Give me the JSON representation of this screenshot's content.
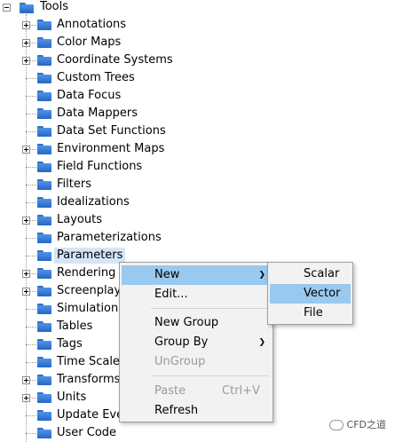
{
  "tree": {
    "root": {
      "label": "Tools",
      "expanded": true
    },
    "items": [
      {
        "label": "Annotations",
        "expandable": true
      },
      {
        "label": "Color Maps",
        "expandable": true
      },
      {
        "label": "Coordinate Systems",
        "expandable": true
      },
      {
        "label": "Custom Trees",
        "expandable": false
      },
      {
        "label": "Data Focus",
        "expandable": false
      },
      {
        "label": "Data Mappers",
        "expandable": false
      },
      {
        "label": "Data Set Functions",
        "expandable": false
      },
      {
        "label": "Environment Maps",
        "expandable": true
      },
      {
        "label": "Field Functions",
        "expandable": false
      },
      {
        "label": "Filters",
        "expandable": false
      },
      {
        "label": "Idealizations",
        "expandable": false
      },
      {
        "label": "Layouts",
        "expandable": true
      },
      {
        "label": "Parameterizations",
        "expandable": false
      },
      {
        "label": "Parameters",
        "expandable": false,
        "selected": true
      },
      {
        "label": "Rendering M",
        "expandable": true
      },
      {
        "label": "Screenplays",
        "expandable": true
      },
      {
        "label": "Simulation",
        "expandable": false
      },
      {
        "label": "Tables",
        "expandable": false
      },
      {
        "label": "Tags",
        "expandable": false
      },
      {
        "label": "Time Scales",
        "expandable": false
      },
      {
        "label": "Transforms",
        "expandable": true
      },
      {
        "label": "Units",
        "expandable": true
      },
      {
        "label": "Update Eve",
        "expandable": false
      },
      {
        "label": "User Code",
        "expandable": false
      }
    ]
  },
  "context_menu": {
    "items": [
      {
        "label": "New",
        "submenu": true,
        "highlighted": true
      },
      {
        "label": "Edit..."
      },
      {
        "separator": true
      },
      {
        "label": "New Group"
      },
      {
        "label": "Group By",
        "submenu": true
      },
      {
        "label": "UnGroup",
        "disabled": true
      },
      {
        "separator": true
      },
      {
        "label": "Paste",
        "shortcut": "Ctrl+V",
        "disabled": true
      },
      {
        "label": "Refresh"
      }
    ],
    "arrow_glyph": "❯"
  },
  "submenu_new": {
    "items": [
      {
        "label": "Scalar"
      },
      {
        "label": "Vector",
        "highlighted": true
      },
      {
        "label": "File"
      }
    ]
  },
  "watermark": {
    "text": "CFD之道"
  }
}
